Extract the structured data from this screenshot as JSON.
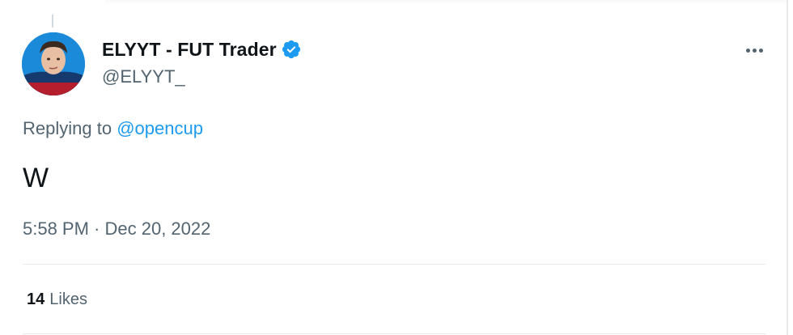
{
  "tweet": {
    "author": {
      "display_name": "ELYYT - FUT Trader",
      "handle": "@ELYYT_",
      "verified_icon": "verified-badge-icon",
      "avatar": "user-avatar"
    },
    "reply_prefix": "Replying to ",
    "reply_to": "@opencup",
    "text": "W",
    "time": "5:58 PM",
    "separator": " · ",
    "date": "Dec 20, 2022",
    "likes_count": "14",
    "likes_label": "Likes",
    "more_icon": "more-horizontal-icon"
  },
  "colors": {
    "text_primary": "#0f1419",
    "text_secondary": "#536471",
    "accent": "#1d9bf0",
    "divider": "#e7e9eb"
  }
}
